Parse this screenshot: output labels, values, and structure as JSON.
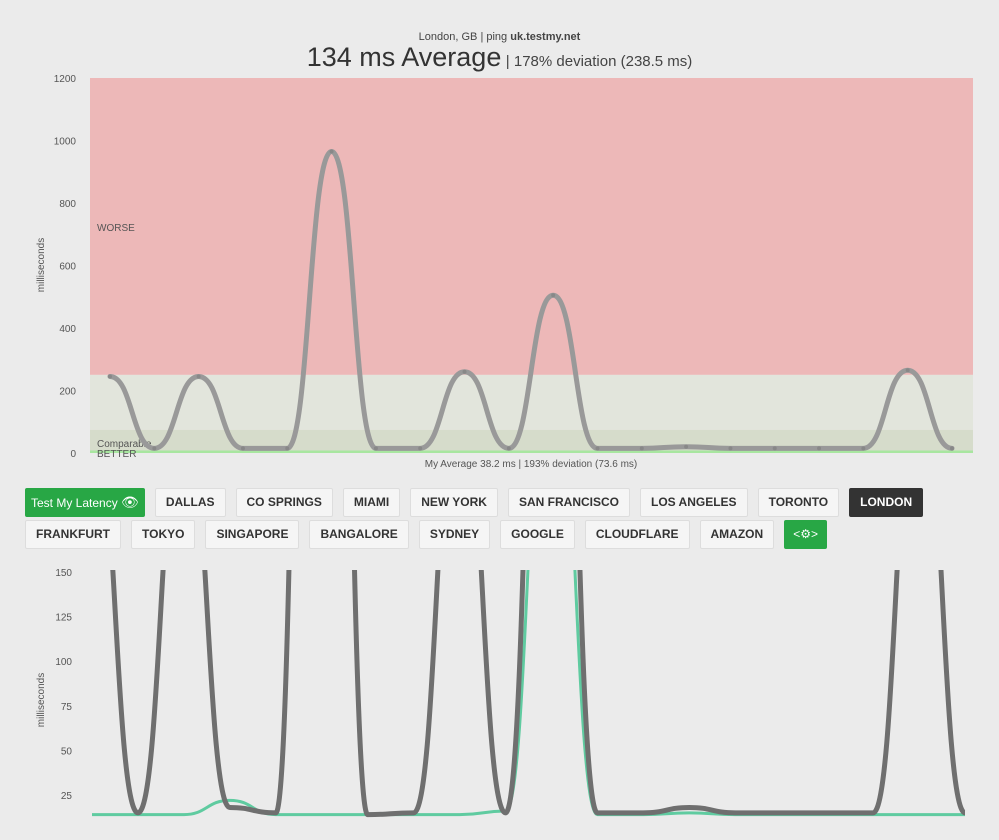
{
  "header": {
    "location": "London, GB",
    "ping_label": "| ping",
    "host": "uk.testmy.net",
    "average": "134 ms Average",
    "deviation": "| 178% deviation (238.5 ms)"
  },
  "top_chart_footer": "My Average 38.2 ms | 193% deviation (73.6 ms)",
  "buttons_row1": {
    "test": "Test My Latency",
    "items": [
      "DALLAS",
      "CO SPRINGS",
      "MIAMI",
      "NEW YORK",
      "SAN FRANCISCO",
      "LOS ANGELES",
      "TORONTO",
      "LONDON"
    ],
    "active": "LONDON"
  },
  "buttons_row2": [
    "FRANKFURT",
    "TOKYO",
    "SINGAPORE",
    "BANGALORE",
    "SYDNEY",
    "GOOGLE",
    "CLOUDFLARE",
    "AMAZON"
  ],
  "colors": {
    "worse": "#edb8b8",
    "comparable": "#e2e5dc",
    "better": "#d6dccb",
    "better_line": "#a8e6a0",
    "server_line": "#999999",
    "my_line": "#5fcba0",
    "button_green": "#28a745"
  },
  "chart_data": [
    {
      "type": "line",
      "ylabel": "milliseconds",
      "ylim": [
        0,
        1200
      ],
      "yticks": [
        0,
        200,
        400,
        600,
        800,
        1000,
        1200
      ],
      "zones": [
        {
          "label": "WORSE",
          "from": 250,
          "to": 1200
        },
        {
          "label": "Comparable",
          "from": 74,
          "to": 250
        },
        {
          "label": "BETTER",
          "from": 0,
          "to": 74
        }
      ],
      "series": [
        {
          "values": [
            245,
            15,
            245,
            15,
            15,
            965,
            15,
            15,
            260,
            15,
            505,
            15,
            15,
            20,
            15,
            15,
            15,
            15,
            265,
            15
          ]
        }
      ]
    },
    {
      "type": "line",
      "ylabel": "milliseconds",
      "ylim": [
        0,
        150
      ],
      "yticks": [
        25,
        50,
        75,
        100,
        125,
        150
      ],
      "series": [
        {
          "values": [
            245,
            15,
            245,
            18,
            15,
            965,
            14,
            15,
            260,
            15,
            505,
            15,
            15,
            18,
            15,
            15,
            15,
            15,
            265,
            15
          ]
        },
        {
          "values": [
            14,
            14,
            14,
            22,
            14,
            14,
            14,
            14,
            14,
            16,
            300,
            14,
            14,
            15,
            14,
            14,
            14,
            14,
            14,
            14
          ]
        }
      ]
    }
  ]
}
